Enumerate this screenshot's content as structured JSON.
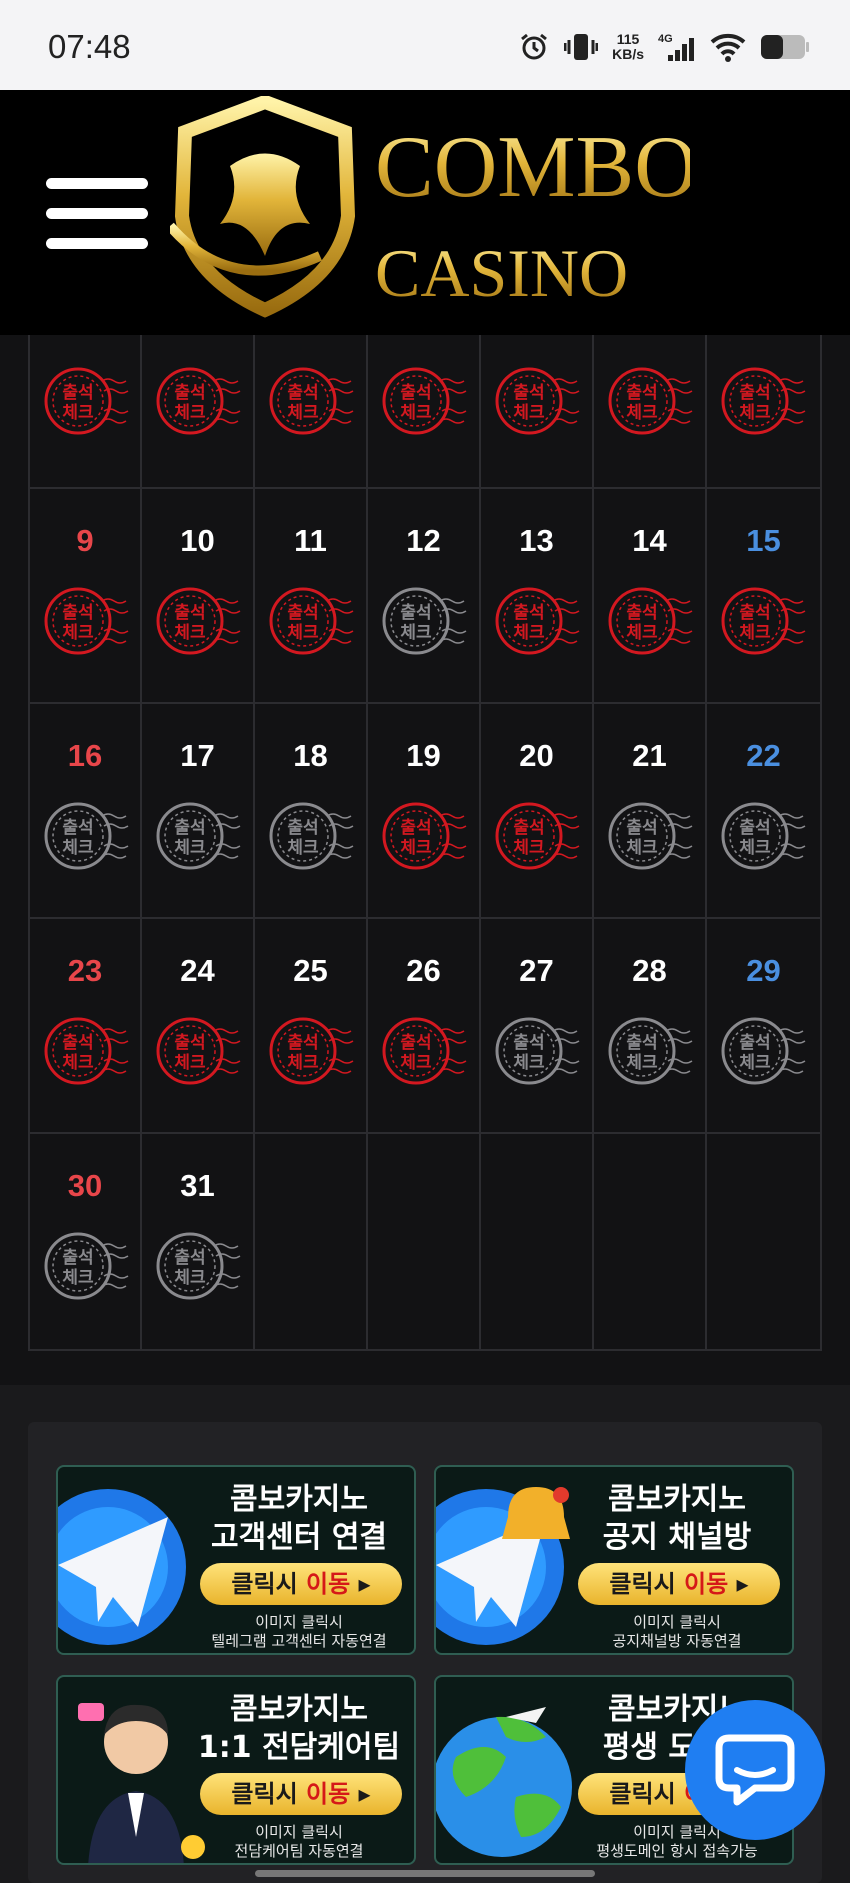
{
  "status_bar": {
    "time": "07:48",
    "net_speed": "115",
    "net_unit": "KB/s",
    "net_type": "4G"
  },
  "header": {
    "brand_top": "COMBO",
    "brand_bottom": "CASINO"
  },
  "calendar": {
    "stamp_text_line1": "출석",
    "stamp_text_line2": "체크",
    "rows": [
      {
        "days": [
          {
            "num": "",
            "checked": true
          },
          {
            "num": "",
            "checked": true
          },
          {
            "num": "",
            "checked": true
          },
          {
            "num": "",
            "checked": true
          },
          {
            "num": "",
            "checked": true
          },
          {
            "num": "",
            "checked": true
          },
          {
            "num": "",
            "checked": true
          }
        ]
      },
      {
        "days": [
          {
            "num": "9",
            "checked": true
          },
          {
            "num": "10",
            "checked": true
          },
          {
            "num": "11",
            "checked": true
          },
          {
            "num": "12",
            "checked": false
          },
          {
            "num": "13",
            "checked": true
          },
          {
            "num": "14",
            "checked": true
          },
          {
            "num": "15",
            "checked": true
          }
        ]
      },
      {
        "days": [
          {
            "num": "16",
            "checked": false
          },
          {
            "num": "17",
            "checked": false
          },
          {
            "num": "18",
            "checked": false
          },
          {
            "num": "19",
            "checked": true
          },
          {
            "num": "20",
            "checked": true
          },
          {
            "num": "21",
            "checked": false
          },
          {
            "num": "22",
            "checked": false
          }
        ]
      },
      {
        "days": [
          {
            "num": "23",
            "checked": true
          },
          {
            "num": "24",
            "checked": true
          },
          {
            "num": "25",
            "checked": true
          },
          {
            "num": "26",
            "checked": true
          },
          {
            "num": "27",
            "checked": false
          },
          {
            "num": "28",
            "checked": false
          },
          {
            "num": "29",
            "checked": false
          }
        ]
      },
      {
        "days": [
          {
            "num": "30",
            "checked": false
          },
          {
            "num": "31",
            "checked": false
          },
          {
            "num": "",
            "empty": true
          },
          {
            "num": "",
            "empty": true
          },
          {
            "num": "",
            "empty": true
          },
          {
            "num": "",
            "empty": true
          },
          {
            "num": "",
            "empty": true
          }
        ]
      }
    ],
    "colors": {
      "sunday": "#e8464a",
      "saturday": "#4a8fe0",
      "weekday": "#ffffff",
      "stamp_active": "#d31820",
      "stamp_inactive": "#8a8a8e"
    }
  },
  "banners": [
    {
      "title_line1": "콤보카지노",
      "title_line2": "고객센터 연결",
      "button_a": "클릭시 ",
      "button_b": "이동",
      "sub_line1": "이미지 클릭시",
      "sub_line2": "텔레그램 고객센터 자동연결",
      "icon": "telegram-icon"
    },
    {
      "title_line1": "콤보카지노",
      "title_line2": "공지 채널방",
      "button_a": "클릭시 ",
      "button_b": "이동",
      "sub_line1": "이미지 클릭시",
      "sub_line2": "공지채널방 자동연결",
      "icon": "bell-telegram-icon"
    },
    {
      "title_line1": "콤보카지노",
      "title_line2": "1:1 전담케어팀",
      "button_a": "클릭시 ",
      "button_b": "이동",
      "sub_line1": "이미지 클릭시",
      "sub_line2": "전담케어팀 자동연결",
      "icon": "agent-avatar-icon"
    },
    {
      "title_line1": "콤보카지노",
      "title_line2": "평생 도메인",
      "button_a": "클릭시 ",
      "button_b": "이동",
      "sub_line1": "이미지 클릭시",
      "sub_line2": "평생도메인 항시 접속가능",
      "icon": "globe-icon"
    }
  ],
  "chat_button": {
    "icon": "chat-bubble-icon"
  }
}
